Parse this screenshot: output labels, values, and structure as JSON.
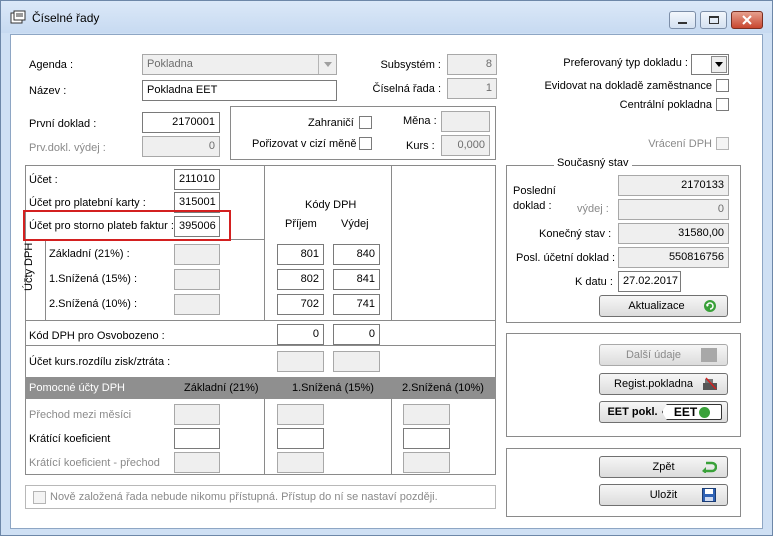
{
  "window": {
    "title": "Číselné řady"
  },
  "top": {
    "agenda_label": "Agenda :",
    "agenda_value": "Pokladna",
    "nazev_label": "Název :",
    "nazev_value": "Pokladna EET",
    "subsystem_label": "Subsystém :",
    "subsystem_value": "8",
    "ciselna_rada_label": "Číselná řada :",
    "ciselna_rada_value": "1",
    "prvni_doklad_label": "První doklad :",
    "prvni_doklad_value": "2170001",
    "prv_vydej_label": "Prv.dokl. výdej :",
    "prv_vydej_value": "0",
    "zahranici_label": "Zahraničí",
    "porizovat_label": "Pořizovat v cizí měně",
    "mena_label": "Měna :",
    "mena_value": "",
    "kurs_label": "Kurs :",
    "kurs_value": "0,000",
    "preferovany_label": "Preferovaný  typ dokladu :",
    "evidovat_label": "Evidovat na dokladě zaměstnance",
    "centralni_label": "Centrální pokladna",
    "vraceni_label": "Vrácení DPH"
  },
  "accounts": {
    "ucet_label": "Účet :",
    "ucet_value": "211010",
    "karty_label": "Účet pro platební karty :",
    "karty_value": "315001",
    "storno_label": "Účet pro storno plateb faktur :",
    "storno_value": "395006",
    "kody_dph_label": "Kódy DPH",
    "prijem_label": "Příjem",
    "vydej_label": "Výdej",
    "ucty_dph_label": "Účty DPH",
    "zakladni_label": "Základní (21%) :",
    "snizena1_label": "1.Snížená (15%) :",
    "snizena2_label": "2.Snížená (10%) :",
    "zakladni_prijem": "801",
    "zakladni_vydej": "840",
    "snizena1_prijem": "802",
    "snizena1_vydej": "841",
    "snizena2_prijem": "702",
    "snizena2_vydej": "741",
    "osvobozeno_label": "Kód DPH pro Osvobozeno :",
    "osvobozeno_prijem": "0",
    "osvobozeno_vydej": "0",
    "kurs_rozdil_label": "Účet kurs.rozdílu zisk/ztráta :"
  },
  "pomocne": {
    "header": "Pomocné účty DPH",
    "col1": "Základní (21%)",
    "col2": "1.Snížená (15%)",
    "col3": "2.Snížená (10%)",
    "prechod_label": "Přechod mezi měsíci",
    "kraticí_label": "Krátící koeficient",
    "kratici_prechod_label": "Krátící koeficient - přechod"
  },
  "footer_note": "Nově založená řada nebude nikomu přístupná. Přístup do ní se nastaví později.",
  "stav": {
    "title": "Současný stav",
    "posledni_label": "Poslední",
    "doklad_label": "doklad :",
    "vydej_label": "výdej :",
    "posledni_value": "2170133",
    "vydej_value": "0",
    "konecny_label": "Konečný stav :",
    "konecny_value": "31580,00",
    "posl_ucetni_label": "Posl. účetní doklad :",
    "posl_ucetni_value": "550816756",
    "k_datu_label": "K datu :",
    "k_datu_value": "27.02.2017",
    "aktualizace_label": "Aktualizace"
  },
  "buttons": {
    "dalsi_udaje": "Další údaje",
    "regist_pokladna": "Regist.pokladna",
    "eet_pokl": "EET pokl.",
    "eet_logo": "EET",
    "zpet": "Zpět",
    "ulozit": "Uložit"
  },
  "colors": {
    "highlight": "#d32020",
    "graybar": "#8f8f8f",
    "green_icon": "#3aa13a"
  }
}
